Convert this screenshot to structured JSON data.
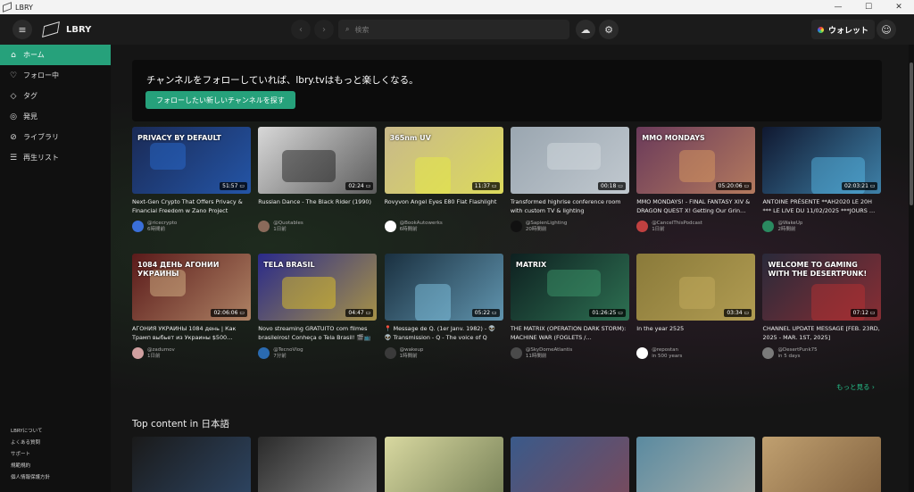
{
  "window": {
    "title": "LBRY",
    "min": "—",
    "max": "☐",
    "close": "✕"
  },
  "header": {
    "brand": "LBRY",
    "search_placeholder": "検索",
    "wallet_label": "ウォレット"
  },
  "sidebar": {
    "items": [
      {
        "label": "ホーム",
        "icon": "home-icon"
      },
      {
        "label": "フォロー中",
        "icon": "heart-icon"
      },
      {
        "label": "タグ",
        "icon": "tag-icon"
      },
      {
        "label": "発見",
        "icon": "compass-icon"
      },
      {
        "label": "ライブラリ",
        "icon": "library-icon"
      },
      {
        "label": "再生リスト",
        "icon": "stack-icon"
      }
    ],
    "footer": [
      "LBRYについて",
      "よくある質問",
      "サポート",
      "規範規約",
      "個人情報保護方針"
    ]
  },
  "banner": {
    "title": "チャンネルをフォローしていれば、lbry.tvはもっと楽しくなる。",
    "button": "フォローしたい新しいチャンネルを探す"
  },
  "row1": [
    {
      "title": "Next-Gen Crypto That Offers Privacy & Financial Freedom w Zano Project",
      "duration": "51:57",
      "channel": "@ricecrypto",
      "time": "6時間前",
      "thumb_text": "PRIVACY BY DEFAULT",
      "bg": "#1a2a55",
      "accent": "#2a6fd8",
      "av": "#3a6fd8"
    },
    {
      "title": "Russian Dance - The Black Rider (1990)",
      "duration": "02:24",
      "channel": "@Quotables",
      "time": "1日前",
      "thumb_text": "",
      "bg": "#d8d8d8",
      "accent": "#111111",
      "av": "#8a6a5a"
    },
    {
      "title": "Rovyvon Angel Eyes E80 Flat Flashlight",
      "duration": "11:37",
      "channel": "@BookAutowerks",
      "time": "6時間前",
      "thumb_text": "365nm UV",
      "bg": "#c8b98a",
      "accent": "#e8ee40",
      "av": "#ffffff"
    },
    {
      "title": "Transformed highrise conference room with custom TV & lighting",
      "duration": "00:18",
      "channel": "@SapienLighting",
      "time": "20時間前",
      "thumb_text": "",
      "bg": "#9aa6b0",
      "accent": "#d8dde2",
      "av": "#111111"
    },
    {
      "title": "MMO MONDAYS! - FINAL FANTASY XIV & DRAGON QUEST X! Getting Our Grin…",
      "duration": "05:20:06",
      "channel": "@CancelThisPodcast",
      "time": "1日前",
      "thumb_text": "MMO MONDAYS",
      "bg": "#6a3a5a",
      "accent": "#e0a060",
      "av": "#c04040"
    },
    {
      "title": "ANTOINE PRÉSENTE **AH2020 LE 20H *** LE LIVE DU 11/02/2025 ***JOURS …",
      "duration": "02:03:21",
      "channel": "@WakeUp",
      "time": "2時間前",
      "thumb_text": "",
      "bg": "#101830",
      "accent": "#5ac0f0",
      "av": "#2a8a60"
    }
  ],
  "row2": [
    {
      "title": "АГОНИЯ УКРАИНЫ 1084 день | Как Трамп выбьет из Украины $500…",
      "duration": "02:06:06",
      "channel": "@zadumov",
      "time": "1日前",
      "thumb_text": "1084 ДЕНЬ АГОНИИ УКРАИНЫ",
      "bg": "#5a1a1a",
      "accent": "#e0c090",
      "av": "#d0a0a0"
    },
    {
      "title": "Novo streaming GRATUITO com filmes brasileiros! Conheça o Tela Brasil! 🎬📺",
      "duration": "04:47",
      "channel": "@TecnoVlog",
      "time": "7分前",
      "thumb_text": "TELA BRASIL",
      "bg": "#2a2a8a",
      "accent": "#f0d020",
      "av": "#2a6ab0"
    },
    {
      "title": "📍 Message de Q. (1er Janv. 1982) - 👽 👽 Transmission - Q - The voice of Q",
      "duration": "05:22",
      "channel": "@wakeup",
      "time": "1時間前",
      "thumb_text": "",
      "bg": "#1a3040",
      "accent": "#8ad0f0",
      "av": "#3a3a3a"
    },
    {
      "title": "THE MATRIX (OPERATION DARK STORM): MACHINE WAR (FOGLETS /…",
      "duration": "01:26:25",
      "channel": "@SkyDomeAtlantis",
      "time": "11時間前",
      "thumb_text": "MATRIX",
      "bg": "#0e2020",
      "accent": "#40a070",
      "av": "#4a4a4a"
    },
    {
      "title": "In the year 2525",
      "duration": "03:34",
      "channel": "@repostan",
      "time": "in 500 years",
      "thumb_text": "",
      "bg": "#8a7a3a",
      "accent": "#c8b060",
      "av": "#ffffff"
    },
    {
      "title": "CHANNEL UPDATE MESSAGE [FEB. 23RD, 2025 - MAR. 1ST, 2025]",
      "duration": "07:12",
      "channel": "@DesertPunk75",
      "time": "in 5 days",
      "thumb_text": "WELCOME TO GAMING WITH THE DESERTPUNK!",
      "bg": "#2a2a3a",
      "accent": "#c03030",
      "av": "#7a7a7a"
    }
  ],
  "more_link": "もっと見る ›",
  "section_title": "Top content in 日本語",
  "row3": [
    {
      "bg": "#1a1a1a",
      "accent": "#3a6090"
    },
    {
      "bg": "#2a2a2a",
      "accent": "#c8c8c8"
    },
    {
      "bg": "#d8d8a0",
      "accent": "#3a4a2a"
    },
    {
      "bg": "#3a5a8a",
      "accent": "#a04040"
    },
    {
      "bg": "#5a8aa0",
      "accent": "#e0c8b0"
    },
    {
      "bg": "#c0a070",
      "accent": "#5a3a20"
    }
  ]
}
